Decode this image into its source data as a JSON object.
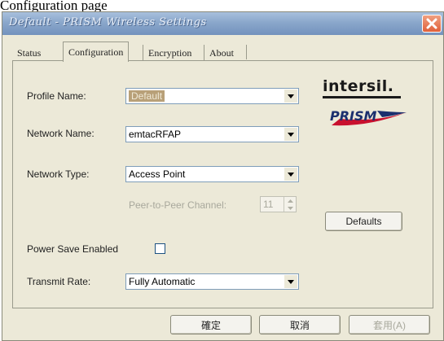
{
  "caption": "Configuration page",
  "window": {
    "title": "Default - PRISM Wireless Settings"
  },
  "tabs": [
    {
      "label": "Status"
    },
    {
      "label": "Configuration"
    },
    {
      "label": "Encryption"
    },
    {
      "label": "About"
    }
  ],
  "logos": {
    "company": "intersil.",
    "product": "PRISM"
  },
  "form": {
    "profile_name": {
      "label": "Profile Name:",
      "value": "Default"
    },
    "network_name": {
      "label": "Network Name:",
      "value": "emtacRFAP"
    },
    "network_type": {
      "label": "Network Type:",
      "value": "Access Point"
    },
    "peer_channel": {
      "label": "Peer-to-Peer Channel:",
      "value": "11"
    },
    "power_save": {
      "label": "Power Save Enabled",
      "checked": false
    },
    "transmit_rate": {
      "label": "Transmit Rate:",
      "value": "Fully Automatic"
    }
  },
  "buttons": {
    "defaults": "Defaults",
    "ok": "確定",
    "cancel": "取消",
    "apply": "套用(A)"
  },
  "colors": {
    "title_bar": "#8aa7cb",
    "close_button": "#e0603a",
    "face": "#ece9d8",
    "prism_red": "#c8102e",
    "prism_blue": "#1b2f6e"
  }
}
